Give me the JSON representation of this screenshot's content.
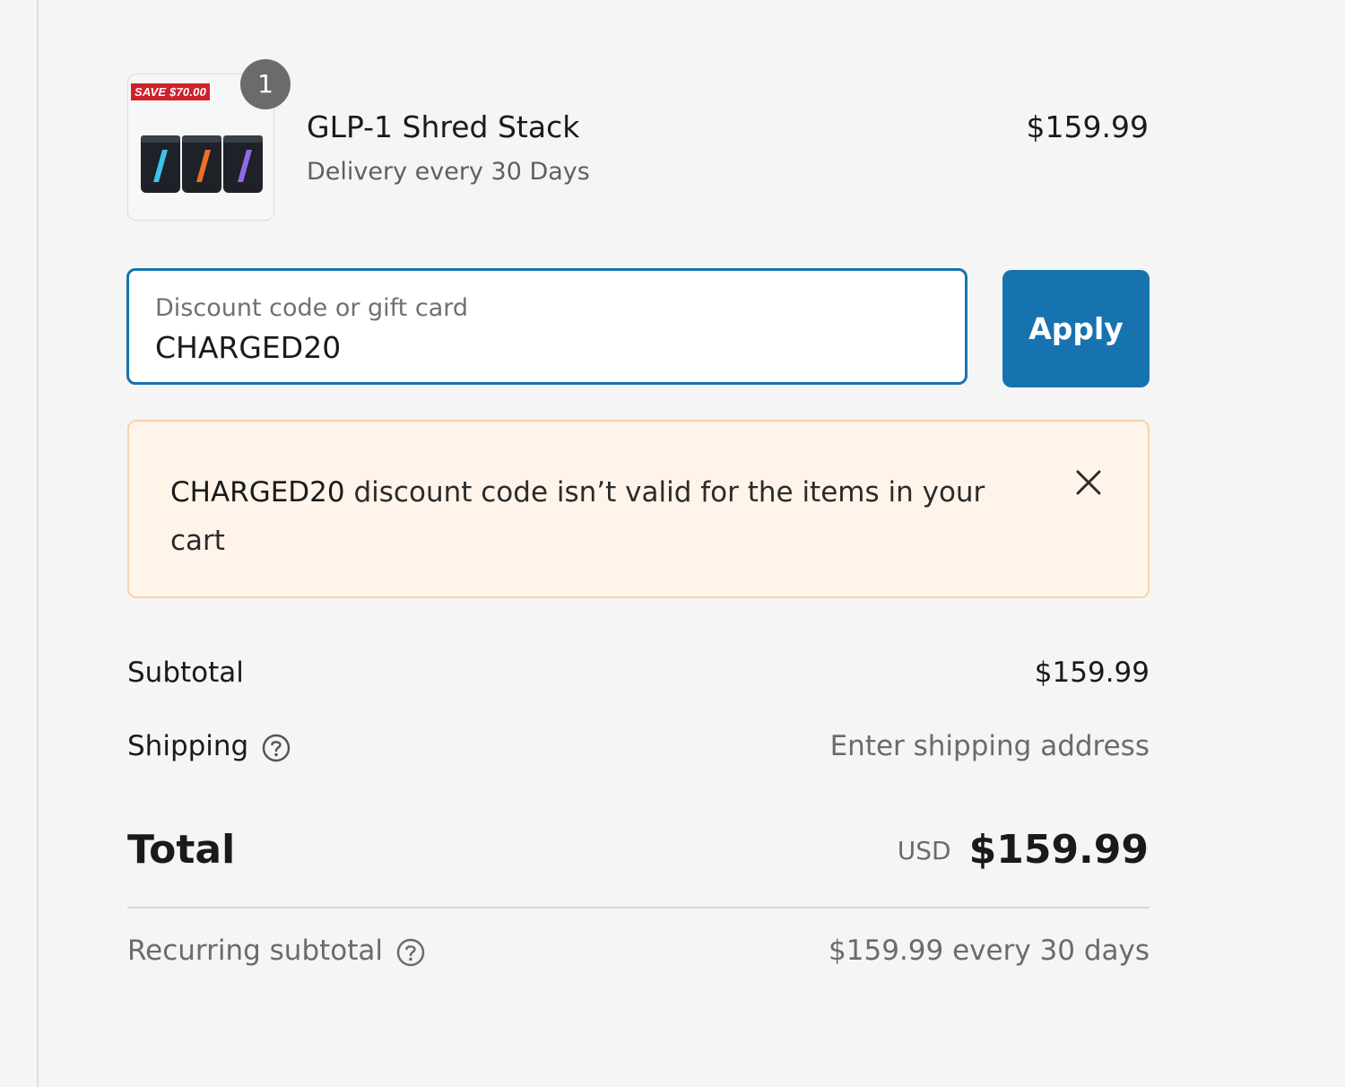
{
  "product": {
    "save_tag": "SAVE $70.00",
    "quantity": "1",
    "name": "GLP-1 Shred Stack",
    "delivery": "Delivery every 30 Days",
    "price": "$159.99"
  },
  "discount": {
    "label": "Discount code or gift card",
    "value": "CHARGED20",
    "apply_label": "Apply"
  },
  "error": {
    "code": "CHARGED20",
    "message": " discount code isn’t valid for the items in your cart"
  },
  "summary": {
    "subtotal_label": "Subtotal",
    "subtotal_value": "$159.99",
    "shipping_label": "Shipping",
    "shipping_value": "Enter shipping address",
    "total_label": "Total",
    "currency": "USD",
    "total_value": "$159.99",
    "recurring_label": "Recurring subtotal",
    "recurring_value": "$159.99 every 30 days"
  },
  "colors": {
    "accent": "#1773b0",
    "error_bg": "#fff4ea",
    "error_border": "#f6d3ad",
    "save_tag": "#d0202a"
  }
}
